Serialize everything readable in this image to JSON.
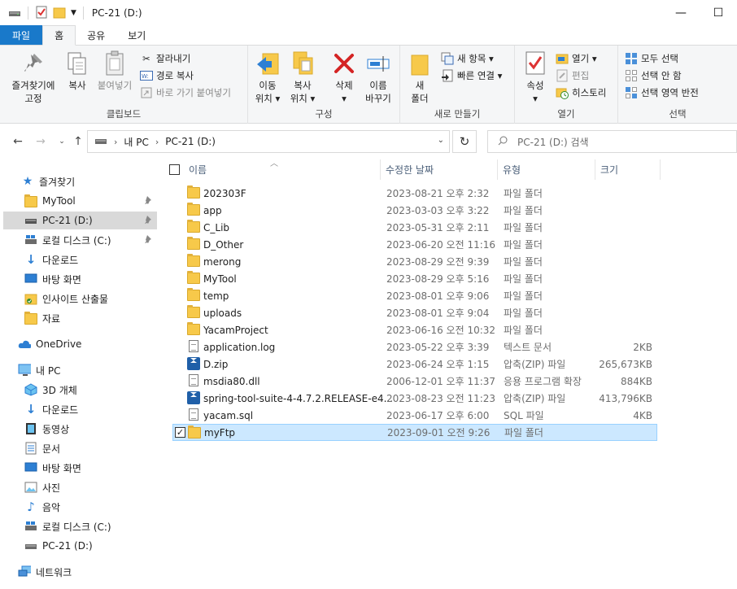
{
  "window": {
    "title": "PC-21 (D:)",
    "minimize": "—",
    "maximize": "☐"
  },
  "ribbon_tabs": [
    "파일",
    "홈",
    "공유",
    "보기"
  ],
  "ribbon": {
    "clipboard": {
      "label": "클립보드",
      "pin": "즐겨찾기에\n고정",
      "copy": "복사",
      "paste": "붙여넣기",
      "cut": "잘라내기",
      "copy_path": "경로 복사",
      "paste_shortcut": "바로 가기 붙여넣기"
    },
    "organize": {
      "label": "구성",
      "move_to": "이동\n위치 ▾",
      "copy_to": "복사\n위치 ▾",
      "delete": "삭제\n▾",
      "rename": "이름\n바꾸기"
    },
    "new": {
      "label": "새로 만들기",
      "new_folder": "새\n폴더",
      "new_item": "새 항목 ▾",
      "easy_access": "빠른 연결 ▾"
    },
    "open": {
      "label": "열기",
      "properties": "속성\n▾",
      "open": "열기 ▾",
      "edit": "편집",
      "history": "히스토리"
    },
    "select": {
      "label": "선택",
      "select_all": "모두 선택",
      "select_none": "선택 안 함",
      "invert": "선택 영역 반전"
    }
  },
  "address": {
    "crumbs": [
      "내 PC",
      "PC-21 (D:)"
    ],
    "search_placeholder": "PC-21 (D:) 검색"
  },
  "sidebar": {
    "items": [
      {
        "label": "즐겨찾기",
        "icon": "star-icon"
      },
      {
        "label": "MyTool",
        "icon": "folder-icon",
        "pinned": true
      },
      {
        "label": "PC-21 (D:)",
        "icon": "drive-icon",
        "pinned": true,
        "selected": true
      },
      {
        "label": "로컬 디스크 (C:)",
        "icon": "drive-icon",
        "pinned": true
      },
      {
        "label": "다운로드",
        "icon": "download-icon"
      },
      {
        "label": "바탕 화면",
        "icon": "desktop-icon"
      },
      {
        "label": "인사이트 산출물",
        "icon": "folder-icon"
      },
      {
        "label": "자료",
        "icon": "folder-icon"
      },
      {
        "label": "OneDrive",
        "icon": "cloud-icon"
      },
      {
        "label": "내 PC",
        "icon": "pc-icon"
      },
      {
        "label": "3D 개체",
        "icon": "cube-icon"
      },
      {
        "label": "다운로드",
        "icon": "download-icon"
      },
      {
        "label": "동영상",
        "icon": "video-icon"
      },
      {
        "label": "문서",
        "icon": "document-icon"
      },
      {
        "label": "바탕 화면",
        "icon": "desktop-icon"
      },
      {
        "label": "사진",
        "icon": "pictures-icon"
      },
      {
        "label": "음악",
        "icon": "music-icon"
      },
      {
        "label": "로컬 디스크 (C:)",
        "icon": "drive-icon"
      },
      {
        "label": "PC-21 (D:)",
        "icon": "drive-icon"
      },
      {
        "label": "네트워크",
        "icon": "network-icon"
      }
    ]
  },
  "columns": [
    "이름",
    "수정한 날짜",
    "유형",
    "크기"
  ],
  "files": [
    {
      "name": "202303F",
      "date": "2023-08-21 오후 2:32",
      "type": "파일 폴더",
      "size": "",
      "kind": "folder"
    },
    {
      "name": "app",
      "date": "2023-03-03 오후 3:22",
      "type": "파일 폴더",
      "size": "",
      "kind": "folder"
    },
    {
      "name": "C_Lib",
      "date": "2023-05-31 오후 2:11",
      "type": "파일 폴더",
      "size": "",
      "kind": "folder"
    },
    {
      "name": "D_Other",
      "date": "2023-06-20 오전 11:16",
      "type": "파일 폴더",
      "size": "",
      "kind": "folder"
    },
    {
      "name": "merong",
      "date": "2023-08-29 오전 9:39",
      "type": "파일 폴더",
      "size": "",
      "kind": "folder"
    },
    {
      "name": "MyTool",
      "date": "2023-08-29 오후 5:16",
      "type": "파일 폴더",
      "size": "",
      "kind": "folder"
    },
    {
      "name": "temp",
      "date": "2023-08-01 오후 9:06",
      "type": "파일 폴더",
      "size": "",
      "kind": "folder"
    },
    {
      "name": "uploads",
      "date": "2023-08-01 오후 9:04",
      "type": "파일 폴더",
      "size": "",
      "kind": "folder"
    },
    {
      "name": "YacamProject",
      "date": "2023-06-16 오전 10:32",
      "type": "파일 폴더",
      "size": "",
      "kind": "folder"
    },
    {
      "name": "application.log",
      "date": "2023-05-22 오후 3:39",
      "type": "텍스트 문서",
      "size": "2KB",
      "kind": "doc"
    },
    {
      "name": "D.zip",
      "date": "2023-06-24 오후 1:15",
      "type": "압축(ZIP) 파일",
      "size": "265,673KB",
      "kind": "zip"
    },
    {
      "name": "msdia80.dll",
      "date": "2006-12-01 오후 11:37",
      "type": "응용 프로그램 확장",
      "size": "884KB",
      "kind": "doc"
    },
    {
      "name": "spring-tool-suite-4-4.7.2.RELEASE-e4...",
      "date": "2023-08-23 오전 11:23",
      "type": "압축(ZIP) 파일",
      "size": "413,796KB",
      "kind": "zip"
    },
    {
      "name": "yacam.sql",
      "date": "2023-06-17 오후 6:00",
      "type": "SQL 파일",
      "size": "4KB",
      "kind": "doc"
    },
    {
      "name": "myFtp",
      "date": "2023-09-01 오전 9:26",
      "type": "파일 폴더",
      "size": "",
      "kind": "folder",
      "selected": true
    }
  ],
  "colors": {
    "file_tab": "#1979ca",
    "selection": "#cce8ff",
    "selection_border": "#99d1ff"
  }
}
